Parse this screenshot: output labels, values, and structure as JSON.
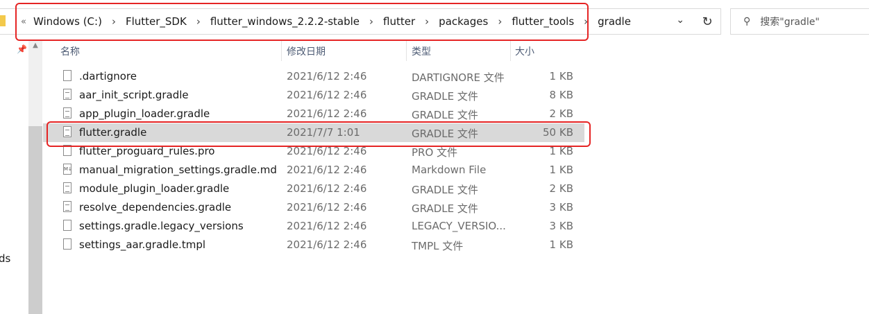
{
  "address": {
    "prefix": "«",
    "crumbs": [
      "Windows (C:)",
      "Flutter_SDK",
      "flutter_windows_2.2.2-stable",
      "flutter",
      "packages",
      "flutter_tools",
      "gradle"
    ],
    "separator": "›",
    "dropdown_icon": "chevron-down-icon"
  },
  "refresh_icon": "refresh-icon",
  "search": {
    "icon": "search-icon",
    "placeholder": "搜索\"gradle\""
  },
  "nav": {
    "partial_text": "ds",
    "pin_icon": "pin-icon"
  },
  "columns": {
    "name": "名称",
    "date": "修改日期",
    "type": "类型",
    "size": "大小"
  },
  "files": [
    {
      "name": ".dartignore",
      "date": "2021/6/12 2:46",
      "type": "DARTIGNORE 文件",
      "size": "1 KB",
      "icon": "blank-file-icon"
    },
    {
      "name": "aar_init_script.gradle",
      "date": "2021/6/12 2:46",
      "type": "GRADLE 文件",
      "size": "8 KB",
      "icon": "text-file-icon"
    },
    {
      "name": "app_plugin_loader.gradle",
      "date": "2021/6/12 2:46",
      "type": "GRADLE 文件",
      "size": "2 KB",
      "icon": "text-file-icon"
    },
    {
      "name": "flutter.gradle",
      "date": "2021/7/7 1:01",
      "type": "GRADLE 文件",
      "size": "50 KB",
      "icon": "text-file-icon",
      "selected": true
    },
    {
      "name": "flutter_proguard_rules.pro",
      "date": "2021/6/12 2:46",
      "type": "PRO 文件",
      "size": "1 KB",
      "icon": "blank-file-icon"
    },
    {
      "name": "manual_migration_settings.gradle.md",
      "date": "2021/6/12 2:46",
      "type": "Markdown File",
      "size": "1 KB",
      "icon": "markdown-file-icon"
    },
    {
      "name": "module_plugin_loader.gradle",
      "date": "2021/6/12 2:46",
      "type": "GRADLE 文件",
      "size": "2 KB",
      "icon": "text-file-icon"
    },
    {
      "name": "resolve_dependencies.gradle",
      "date": "2021/6/12 2:46",
      "type": "GRADLE 文件",
      "size": "3 KB",
      "icon": "text-file-icon"
    },
    {
      "name": "settings.gradle.legacy_versions",
      "date": "2021/6/12 2:46",
      "type": "LEGACY_VERSIO...",
      "size": "3 KB",
      "icon": "blank-file-icon"
    },
    {
      "name": "settings_aar.gradle.tmpl",
      "date": "2021/6/12 2:46",
      "type": "TMPL 文件",
      "size": "1 KB",
      "icon": "blank-file-icon"
    }
  ],
  "colors": {
    "highlight_box": "#e52424",
    "selected_row": "#d9d9d9",
    "header_text": "#4d5b74"
  }
}
